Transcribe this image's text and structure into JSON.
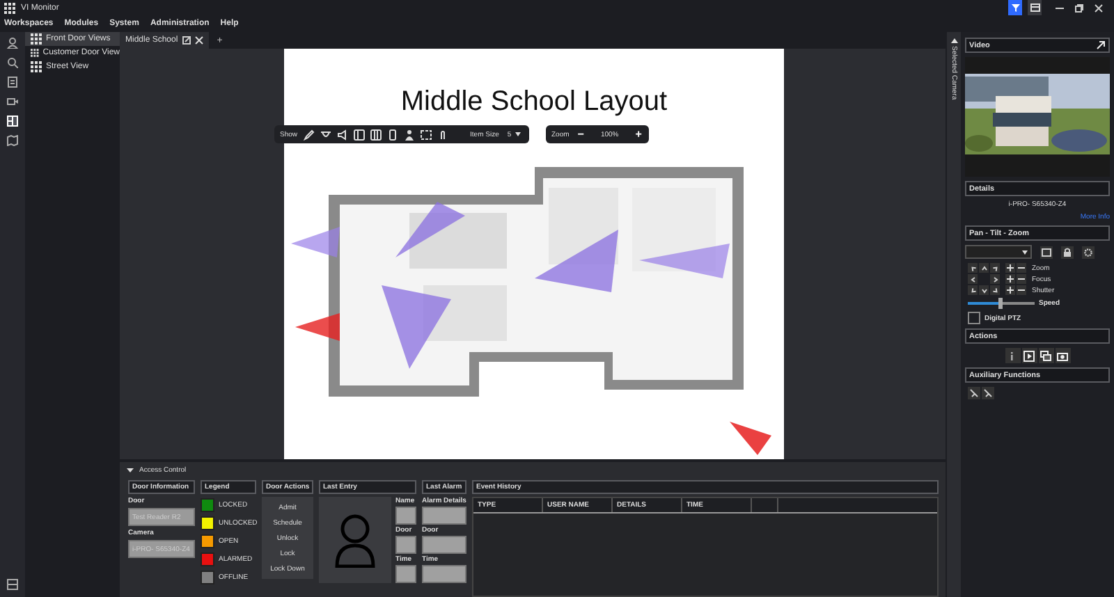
{
  "window": {
    "title": "VI Monitor"
  },
  "title_toggles": [
    {
      "kind": "filter",
      "on": true
    },
    {
      "kind": "layout",
      "on": false
    }
  ],
  "menu": [
    "Workspaces",
    "Modules",
    "System",
    "Administration",
    "Help"
  ],
  "views": [
    {
      "label": "Front Door Views",
      "selected": true
    },
    {
      "label": "Customer Door View",
      "selected": false
    },
    {
      "label": "Street View",
      "selected": false
    }
  ],
  "tabs": [
    {
      "label": "Middle School",
      "selected": true
    }
  ],
  "new_tab": "+",
  "map": {
    "title": "Middle School Layout",
    "show_label": "Show",
    "item_size_label": "Item Size",
    "item_size": "5",
    "zoom_label": "Zoom",
    "zoom_out": "−",
    "zoom": "100%",
    "zoom_in": "+"
  },
  "side_tab": {
    "label": "Selected Camera"
  },
  "right_panel": {
    "video_title": "Video",
    "details_title": "Details",
    "camera": "i-PRO- S65340-Z4",
    "more_info": "More Info",
    "ptz_title": "Pan - Tilt - Zoom",
    "ptz_rows": [
      "Zoom",
      "Focus",
      "Shutter"
    ],
    "speed_label": "Speed",
    "speed": {
      "level": 0.48
    },
    "digital_ptz": {
      "label": "Digital PTZ",
      "checked": false
    },
    "actions_title": "Actions",
    "aux_title": "Auxiliary Functions"
  },
  "access_control": {
    "title": "Access Control",
    "expanded": true,
    "door_info": {
      "title": "Door Information",
      "door_label": "Door",
      "door": "Test Reader R2",
      "camera_label": "Camera",
      "camera": "i-PRO- S65340-Z4"
    },
    "legend": {
      "title": "Legend",
      "items": [
        {
          "label": "LOCKED",
          "color": "#0f8a0f"
        },
        {
          "label": "UNLOCKED",
          "color": "#f2f200"
        },
        {
          "label": "OPEN",
          "color": "#f59a00"
        },
        {
          "label": "ALARMED",
          "color": "#e81010"
        },
        {
          "label": "OFFLINE",
          "color": "#808080"
        }
      ]
    },
    "door_actions": {
      "title": "Door Actions",
      "buttons": [
        "Admit",
        "Schedule",
        "Unlock",
        "Lock",
        "Lock Down"
      ]
    },
    "last_entry": {
      "title": "Last Entry",
      "fields": [
        "Name",
        "Door",
        "Time"
      ]
    },
    "last_alarm": {
      "title": "Last Alarm",
      "fields": [
        "Alarm Details",
        "Door",
        "Time"
      ]
    },
    "event_history": {
      "title": "Event History",
      "columns": [
        "TYPE",
        "USER NAME",
        "DETAILS",
        "TIME"
      ]
    }
  }
}
